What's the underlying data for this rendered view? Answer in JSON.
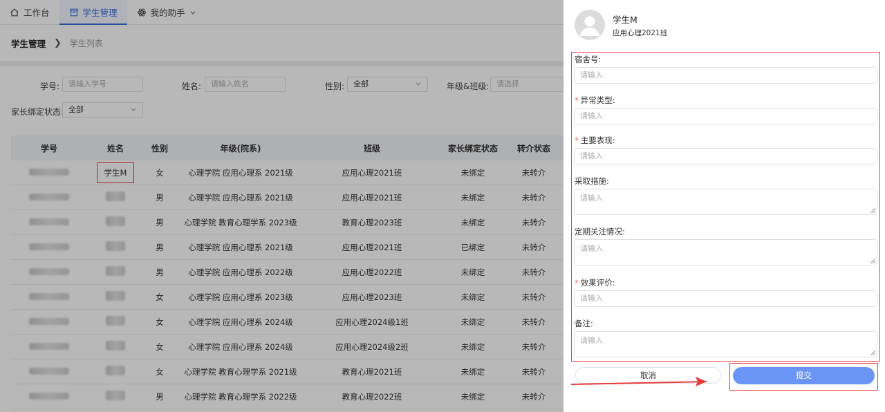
{
  "nav": {
    "tabs": [
      {
        "label": "工作台",
        "icon": "home-icon"
      },
      {
        "label": "学生管理",
        "icon": "archive-icon"
      },
      {
        "label": "我的助手",
        "icon": "atom-icon"
      }
    ]
  },
  "breadcrumb": {
    "root": "学生管理",
    "sep": "❯",
    "current": "学生列表"
  },
  "filters": {
    "student_id": {
      "label": "学号:",
      "placeholder": "请输入学号"
    },
    "name": {
      "label": "姓名:",
      "placeholder": "请输入姓名"
    },
    "gender": {
      "label": "性别:",
      "value": "全部"
    },
    "grade_class": {
      "label": "年级&班级:",
      "placeholder": "请选择"
    },
    "parent_bind": {
      "label": "家长绑定状态:",
      "value": "全部"
    }
  },
  "table": {
    "headers": [
      "学号",
      "姓名",
      "性别",
      "年级(院系)",
      "班级",
      "家长绑定状态",
      "转介状态"
    ],
    "rows": [
      {
        "name": "学生M",
        "gender": "女",
        "grade": "心理学院 应用心理系 2021级",
        "class": "应用心理2021班",
        "bind": "未绑定",
        "referral": "未转介"
      },
      {
        "name": "",
        "gender": "男",
        "grade": "心理学院 应用心理系 2021级",
        "class": "应用心理2021班",
        "bind": "未绑定",
        "referral": "未转介"
      },
      {
        "name": "",
        "gender": "男",
        "grade": "心理学院 教育心理学系 2023级",
        "class": "教育心理2023班",
        "bind": "未绑定",
        "referral": "未转介"
      },
      {
        "name": "",
        "gender": "男",
        "grade": "心理学院 应用心理系 2021级",
        "class": "应用心理2021班",
        "bind": "已绑定",
        "referral": "未转介"
      },
      {
        "name": "",
        "gender": "男",
        "grade": "心理学院 应用心理系 2022级",
        "class": "应用心理2022班",
        "bind": "未绑定",
        "referral": "未转介"
      },
      {
        "name": "",
        "gender": "女",
        "grade": "心理学院 应用心理系 2023级",
        "class": "应用心理2023班",
        "bind": "未绑定",
        "referral": "未转介"
      },
      {
        "name": "",
        "gender": "女",
        "grade": "心理学院 应用心理系 2024级",
        "class": "应用心理2024级1班",
        "bind": "未绑定",
        "referral": "未转介"
      },
      {
        "name": "",
        "gender": "女",
        "grade": "心理学院 应用心理系 2024级",
        "class": "应用心理2024级2班",
        "bind": "未绑定",
        "referral": "未转介"
      },
      {
        "name": "",
        "gender": "女",
        "grade": "心理学院 教育心理学系 2021级",
        "class": "教育心理2021班",
        "bind": "未绑定",
        "referral": "未转介"
      },
      {
        "name": "",
        "gender": "男",
        "grade": "心理学院 教育心理学系 2022级",
        "class": "教育心理2022班",
        "bind": "未绑定",
        "referral": "未转介"
      }
    ]
  },
  "drawer": {
    "student_name": "学生M",
    "student_class": "应用心理2021班",
    "fields": [
      {
        "label": "宿舍号:",
        "required": false,
        "placeholder": "请输入",
        "type": "input"
      },
      {
        "label": "异常类型:",
        "required": true,
        "placeholder": "请输入",
        "type": "input"
      },
      {
        "label": "主要表现:",
        "required": true,
        "placeholder": "请输入",
        "type": "input"
      },
      {
        "label": "采取措施:",
        "required": false,
        "placeholder": "请输入",
        "type": "textarea"
      },
      {
        "label": "定期关注情况:",
        "required": false,
        "placeholder": "请输入",
        "type": "textarea"
      },
      {
        "label": "效果评价:",
        "required": true,
        "placeholder": "请输入",
        "type": "input"
      },
      {
        "label": "备注:",
        "required": false,
        "placeholder": "请输入",
        "type": "textarea"
      }
    ],
    "cancel_label": "取消",
    "submit_label": "提交"
  },
  "colors": {
    "accent": "#3b6fd6",
    "submit": "#6b95f5",
    "highlight": "#e63a3a"
  }
}
